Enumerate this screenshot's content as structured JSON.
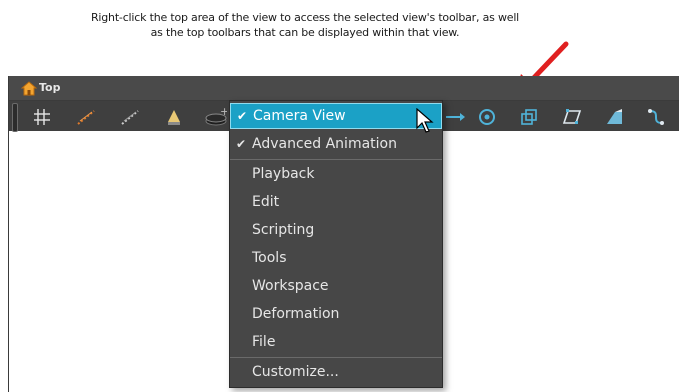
{
  "caption": {
    "line1": "Right-click the top area of the view to access the selected view's toolbar, as well",
    "line2": "as the top toolbars that can be displayed within that view."
  },
  "colors": {
    "arrow": "#e02020",
    "menu_highlight": "#1ba1c6",
    "titlebar": "#4a4a4a",
    "toolbar": "#3f3f3f"
  },
  "view": {
    "title": "Top",
    "title_icon": "home-icon"
  },
  "toolbar": {
    "icons": [
      "grid-icon",
      "onion-skin-icon",
      "light-table-icon",
      "light-icon",
      "disc-icon",
      "motion-arrow-icon",
      "rotate-icon",
      "scale-icon",
      "skew-icon",
      "perspective-icon",
      "transform-icon"
    ]
  },
  "context_menu": {
    "items": [
      {
        "label": "Camera View",
        "checked": true,
        "highlighted": true
      },
      {
        "label": "Advanced Animation",
        "checked": true
      },
      {
        "label": "Playback"
      },
      {
        "label": "Edit"
      },
      {
        "label": "Scripting"
      },
      {
        "label": "Tools"
      },
      {
        "label": "Workspace"
      },
      {
        "label": "Deformation"
      },
      {
        "label": "File"
      },
      {
        "label": "Customize..."
      }
    ]
  }
}
